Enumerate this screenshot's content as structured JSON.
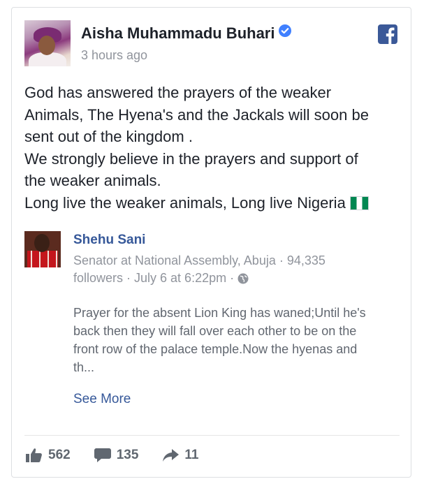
{
  "post": {
    "author": "Aisha Muhammadu Buhari",
    "time": "3 hours ago",
    "lines": [
      "God has answered the prayers of the weaker",
      "Animals, The Hyena's and the Jackals will soon be",
      "sent out of the kingdom .",
      "We strongly believe in the prayers and support of",
      "the weaker animals.",
      "Long live the weaker animals, Long live Nigeria"
    ]
  },
  "shared": {
    "author": "Shehu Sani",
    "meta_line1": "Senator at National Assembly, Abuja · 94,335",
    "meta_line2": "followers · July 6 at 6:22pm ·",
    "body_lines": [
      "Prayer for the absent Lion King has waned;Until he's",
      "back then they will fall over each other to be on the",
      "front row of the palace temple.Now the hyenas and",
      "th..."
    ],
    "see_more": "See More"
  },
  "stats": {
    "likes": "562",
    "comments": "135",
    "shares": "11"
  },
  "icons": {
    "verified": "verified-badge-icon",
    "facebook": "facebook-logo-icon",
    "flag": "nigeria-flag-icon",
    "globe": "globe-icon",
    "like": "thumbs-up-icon",
    "comment": "comment-icon",
    "share": "share-arrow-icon"
  },
  "colors": {
    "link_blue": "#365899",
    "facebook_blue": "#3b5998",
    "verified_blue": "#4080ff",
    "muted_gray": "#90949c"
  }
}
